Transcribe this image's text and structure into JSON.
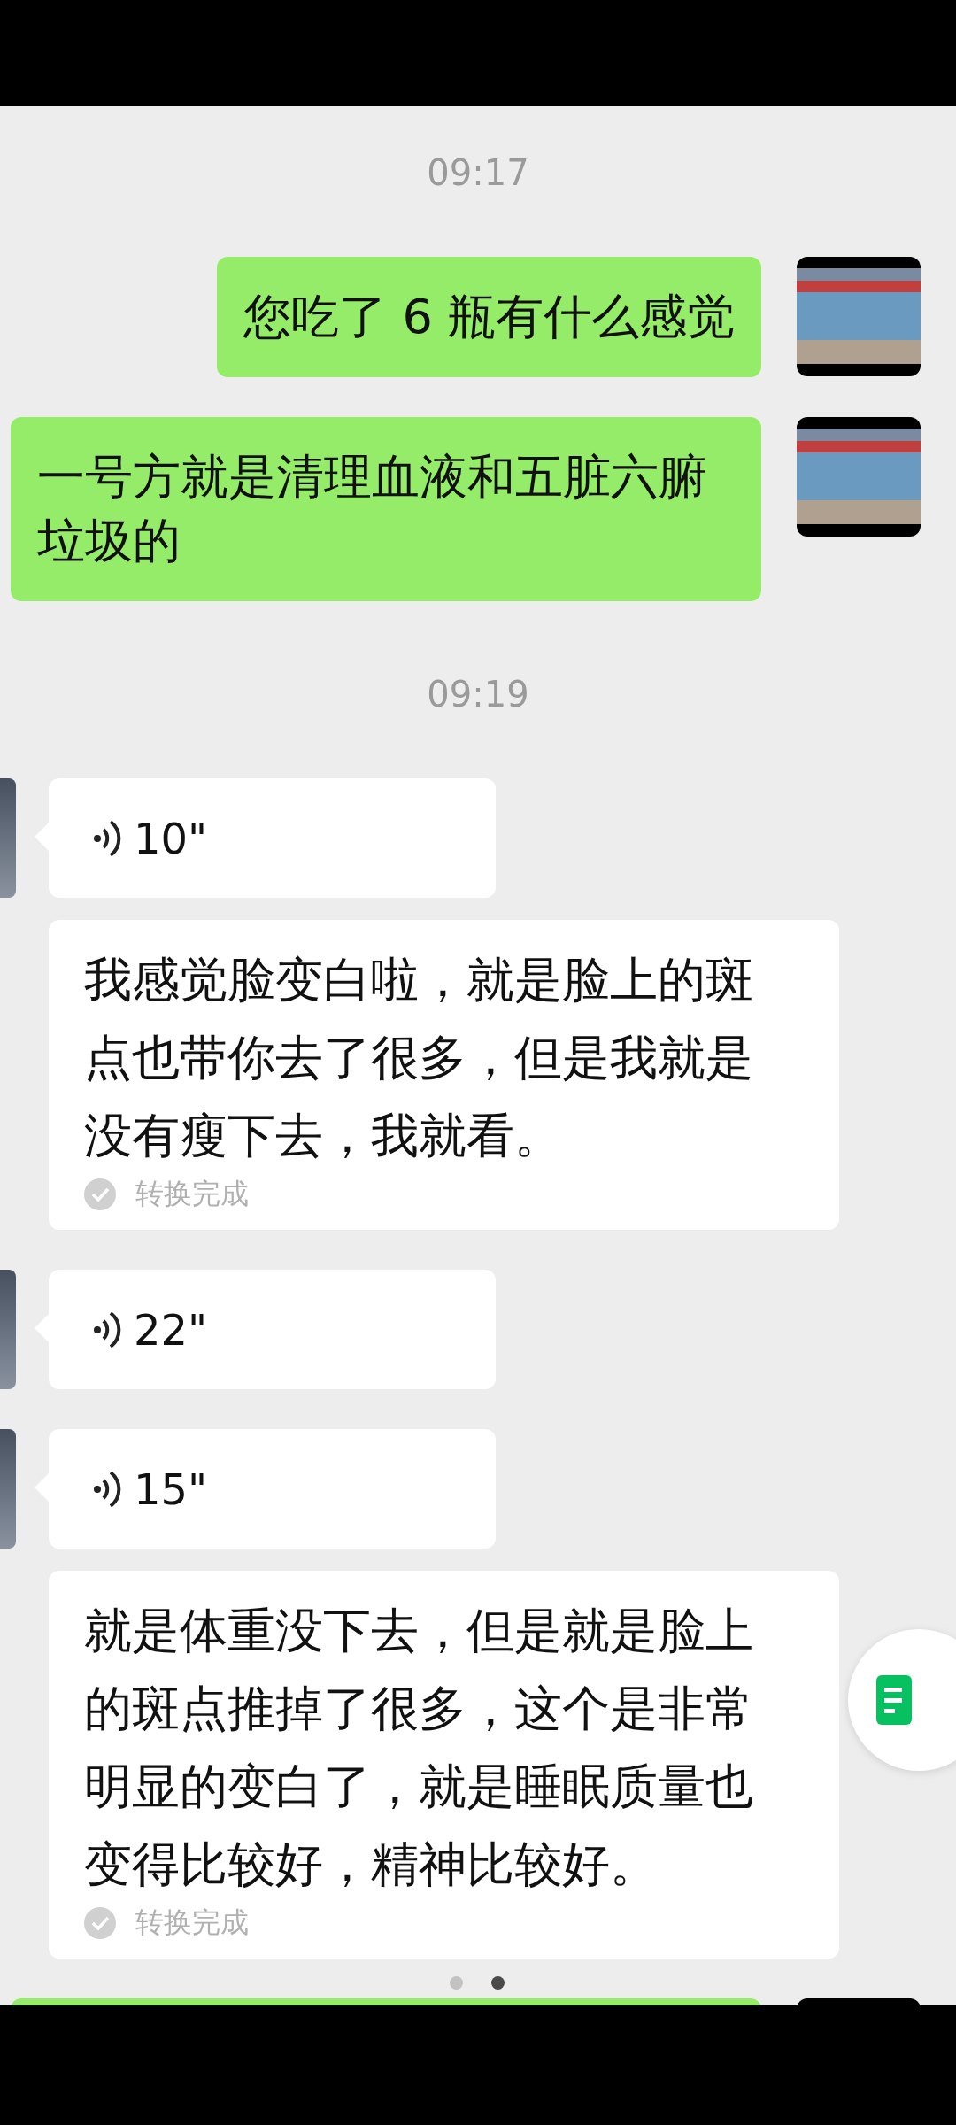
{
  "messages": [
    {
      "kind": "time",
      "text": "09:17"
    },
    {
      "kind": "text",
      "outgoing": true,
      "text": "您吃了 6 瓶有什么感觉"
    },
    {
      "kind": "text",
      "outgoing": true,
      "text": "一号方就是清理血液和五脏六腑垃圾的"
    },
    {
      "kind": "time",
      "text": "09:19"
    },
    {
      "kind": "voice",
      "outgoing": false,
      "duration": "10\""
    },
    {
      "kind": "transcript",
      "outgoing": false,
      "text": "我感觉脸变白啦，就是脸上的斑点也带你去了很多，但是我就是没有瘦下去，我就看。",
      "status": "转换完成"
    },
    {
      "kind": "voice",
      "outgoing": false,
      "duration": "22\""
    },
    {
      "kind": "voice",
      "outgoing": false,
      "duration": "15\""
    },
    {
      "kind": "transcript",
      "outgoing": false,
      "text": "就是体重没下去，但是就是脸上的斑点推掉了很多，这个是非常明显的变白了，就是睡眠质量也变得比较好，精神比较好。",
      "status": "转换完成"
    },
    {
      "kind": "cut",
      "outgoing": true
    }
  ],
  "pager": [
    {
      "selected": false
    },
    {
      "selected": true
    }
  ]
}
